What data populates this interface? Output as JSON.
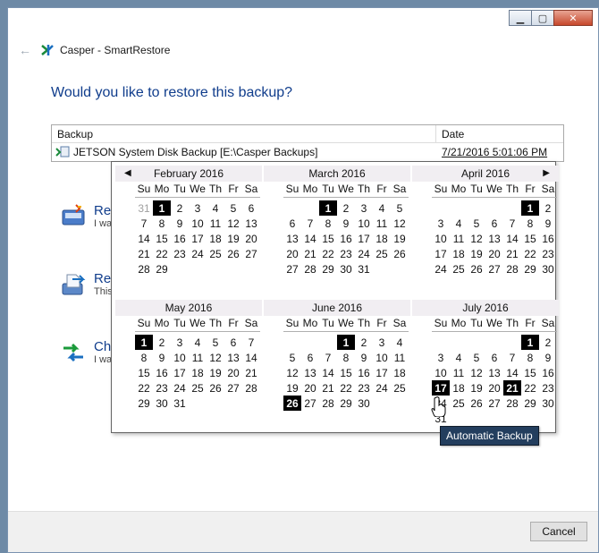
{
  "window": {
    "title": "Casper - SmartRestore"
  },
  "question": "Would you like to restore this backup?",
  "table": {
    "headers": [
      "Backup",
      "Date"
    ],
    "row": {
      "name": "JETSON System Disk Backup [E:\\Casper Backups]",
      "date": "7/21/2016 5:01:06 PM"
    }
  },
  "options": [
    {
      "title": "Re",
      "desc": "I wa"
    },
    {
      "title": "Re",
      "desc": "This"
    },
    {
      "title": "Ch",
      "desc": "I wa"
    }
  ],
  "footer": {
    "cancel_label": "Cancel"
  },
  "calendar": {
    "weekdays": [
      "Su",
      "Mo",
      "Tu",
      "We",
      "Th",
      "Fr",
      "Sa"
    ],
    "months": [
      {
        "name": "February 2016",
        "offset": 0,
        "leading": [
          "31"
        ],
        "days": 29,
        "bold": [
          1
        ]
      },
      {
        "name": "March 2016",
        "offset": 2,
        "leading": [],
        "days": 31,
        "bold": [
          1
        ]
      },
      {
        "name": "April 2016",
        "offset": 5,
        "leading": [],
        "days": 30,
        "bold": [
          1
        ]
      },
      {
        "name": "May 2016",
        "offset": 0,
        "leading": [],
        "days": 31,
        "bold": [
          1
        ]
      },
      {
        "name": "June 2016",
        "offset": 3,
        "leading": [],
        "days": 30,
        "bold": [
          1,
          26
        ]
      },
      {
        "name": "July 2016",
        "offset": 5,
        "leading": [],
        "days": 31,
        "bold": [
          1,
          17,
          21
        ]
      }
    ],
    "tooltip": "Automatic Backup"
  },
  "colors": {
    "accent_text": "#103d8c",
    "tooltip_bg": "#233e5e"
  },
  "icons": {
    "back": "back-arrow-icon",
    "app": "casper-logo-icon"
  }
}
